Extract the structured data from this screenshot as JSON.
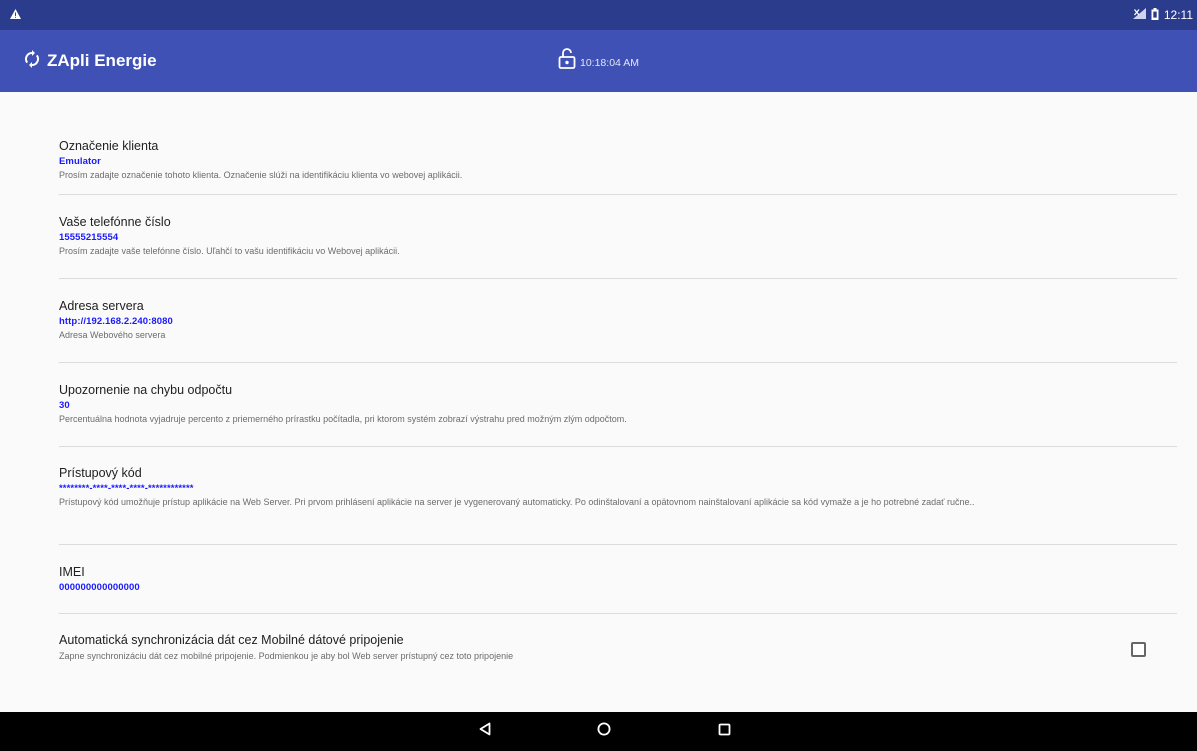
{
  "status_bar": {
    "warning_icon": "warning-triangle-icon",
    "signal_icon": "signal-icon",
    "battery_icon": "battery-icon",
    "time": "12:11"
  },
  "app_bar": {
    "refresh_icon": "sync-icon",
    "title": "ZApli Energie",
    "lock_icon": "unlock-icon",
    "clock": "10:18:04 AM"
  },
  "preferences": [
    {
      "title": "Označenie klienta",
      "value": "Emulator",
      "summary": "Prosím zadajte označenie tohoto klienta. Označenie slúži na identifikáciu klienta vo webovej aplikácii."
    },
    {
      "title": "Vaše telefónne číslo",
      "value": "15555215554",
      "summary": "Prosím zadajte vaše telefónne číslo. Uľahčí to vašu identifikáciu vo Webovej aplikácii."
    },
    {
      "title": "Adresa servera",
      "value": "http://192.168.2.240:8080",
      "summary": "Adresa Webového servera"
    },
    {
      "title": "Upozornenie na chybu odpočtu",
      "value": "30",
      "summary": "Percentuálna hodnota vyjadruje percento z priemerného prírastku počítadla, pri ktorom systém zobrazí výstrahu pred možným zlým odpočtom."
    },
    {
      "title": "Prístupový kód",
      "value": "********-****-****-****-************",
      "summary": "Prístupový kód umožňuje prístup aplikácie na Web Server. Pri prvom prihlásení aplikácie na server je vygenerovaný automaticky. Po odinštalovaní a opätovnom nainštalovaní aplikácie sa kód vymaže a je ho potrebné zadať ručne.."
    },
    {
      "title": "IMEI",
      "value": "000000000000000",
      "summary": ""
    },
    {
      "title": "Automatická synchronizácia dát cez Mobilné dátové pripojenie",
      "summary": "Zapne synchronizáciu dát cez mobilné pripojenie. Podmienkou je aby bol Web server prístupný cez toto pripojenie",
      "checked": false
    }
  ],
  "nav_bar": {
    "back_icon": "back-triangle-icon",
    "home_icon": "home-circle-icon",
    "recents_icon": "recents-square-icon"
  },
  "colors": {
    "status_bar": "#2c3c8c",
    "app_bar": "#3f51b5",
    "value_text": "#1a1aff"
  }
}
